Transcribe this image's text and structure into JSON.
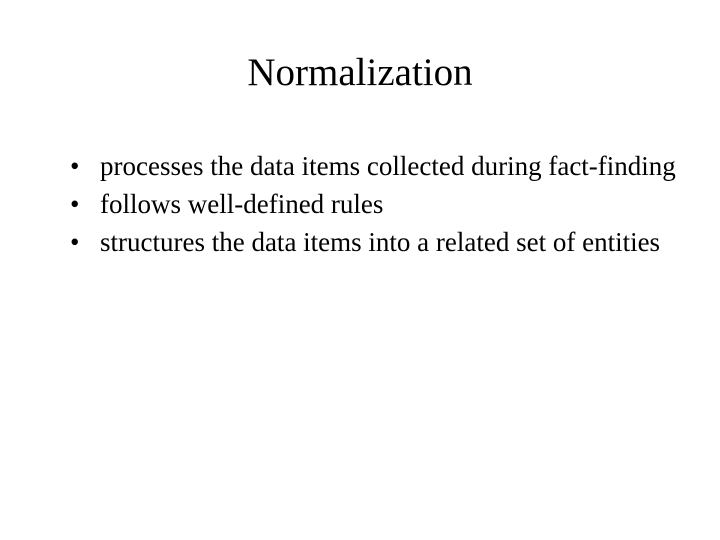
{
  "slide": {
    "title": "Normalization",
    "bullets": [
      "processes the data items collected during fact-finding",
      "follows well-defined rules",
      "structures the data items into a related set of entities"
    ]
  }
}
